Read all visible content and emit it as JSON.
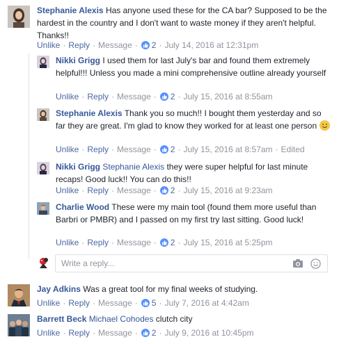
{
  "comments": [
    {
      "author": "Stephanie Alexis",
      "text": "Has anyone used these for the CA bar? Supposed to be the hardest in the country and I don't want to waste money if they aren't helpful. Thanks!!",
      "unlike": "Unlike",
      "reply": "Reply",
      "message": "Message",
      "likes": "2",
      "timestamp": "July 14, 2016 at 12:31pm"
    },
    {
      "author": "Nikki Grigg",
      "text": "I used them for last July's bar and found them extremely helpful!!! Unless you made a mini comprehensive outline already yourself",
      "unlike": "Unlike",
      "reply": "Reply",
      "message": "Message",
      "likes": "2",
      "timestamp": "July 15, 2016 at 8:55am"
    },
    {
      "author": "Stephanie Alexis",
      "text": "Thank you so much!! I bought them yesterday and so far they are great. I'm glad to know they worked for at least one person",
      "unlike": "Unlike",
      "reply": "Reply",
      "message": "Message",
      "likes": "2",
      "timestamp": "July 15, 2016 at 8:57am",
      "edited": "Edited"
    },
    {
      "author": "Nikki Grigg",
      "mention": "Stephanie Alexis",
      "text": "they were super helpful for last minute recaps! Good luck!! You can do this!!",
      "unlike": "Unlike",
      "reply": "Reply",
      "message": "Message",
      "likes": "2",
      "timestamp": "July 15, 2016 at 9:23am"
    },
    {
      "author": "Charlie Wood",
      "text": "These were my main tool (found them more useful than Barbri or PMBR) and I passed on my first try last sitting. Good luck!",
      "unlike": "Unlike",
      "reply": "Reply",
      "message": "Message",
      "likes": "2",
      "timestamp": "July 15, 2016 at 5:25pm"
    },
    {
      "author": "Jay Adkins",
      "text": "Was a great tool for my final weeks of studying.",
      "unlike": "Unlike",
      "reply": "Reply",
      "message": "Message",
      "likes": "5",
      "timestamp": "July 7, 2016 at 4:42am"
    },
    {
      "author": "Barrett Beck",
      "mention": "Michael Cohodes",
      "text": "clutch city",
      "unlike": "Unlike",
      "reply": "Reply",
      "message": "Message",
      "likes": "2",
      "timestamp": "July 9, 2016 at 10:45pm"
    }
  ],
  "reply_box": {
    "placeholder": "Write a reply..."
  },
  "colors": {
    "link": "#365899",
    "meta": "#90949c",
    "like_blue": "#5890ff",
    "border": "#dddfe2"
  },
  "icons": [
    "like-thumb-icon",
    "smiley-emoji-icon",
    "camera-icon",
    "emoji-picker-icon"
  ]
}
